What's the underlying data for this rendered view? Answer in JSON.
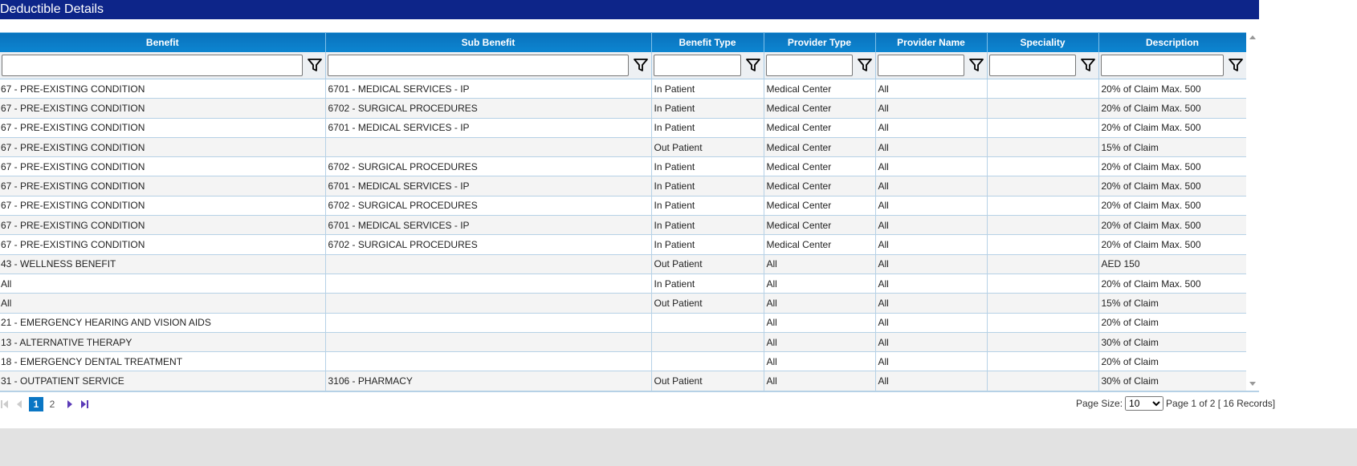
{
  "title": "Deductible Details",
  "columns": [
    "Benefit",
    "Sub Benefit",
    "Benefit Type",
    "Provider Type",
    "Provider Name",
    "Speciality",
    "Description"
  ],
  "rows": [
    [
      "67 - PRE-EXISTING CONDITION",
      "6701 - MEDICAL SERVICES - IP",
      "In Patient",
      "Medical Center",
      "All",
      "",
      "20% of Claim Max. 500"
    ],
    [
      "67 - PRE-EXISTING CONDITION",
      "6702 - SURGICAL PROCEDURES",
      "In Patient",
      "Medical Center",
      "All",
      "",
      "20% of Claim Max. 500"
    ],
    [
      "67 - PRE-EXISTING CONDITION",
      "6701 - MEDICAL SERVICES - IP",
      "In Patient",
      "Medical Center",
      "All",
      "",
      "20% of Claim Max. 500"
    ],
    [
      "67 - PRE-EXISTING CONDITION",
      "",
      "Out Patient",
      "Medical Center",
      "All",
      "",
      "15% of Claim"
    ],
    [
      "67 - PRE-EXISTING CONDITION",
      "6702 - SURGICAL PROCEDURES",
      "In Patient",
      "Medical Center",
      "All",
      "",
      "20% of Claim Max. 500"
    ],
    [
      "67 - PRE-EXISTING CONDITION",
      "6701 - MEDICAL SERVICES - IP",
      "In Patient",
      "Medical Center",
      "All",
      "",
      "20% of Claim Max. 500"
    ],
    [
      "67 - PRE-EXISTING CONDITION",
      "6702 - SURGICAL PROCEDURES",
      "In Patient",
      "Medical Center",
      "All",
      "",
      "20% of Claim Max. 500"
    ],
    [
      "67 - PRE-EXISTING CONDITION",
      "6701 - MEDICAL SERVICES - IP",
      "In Patient",
      "Medical Center",
      "All",
      "",
      "20% of Claim Max. 500"
    ],
    [
      "67 - PRE-EXISTING CONDITION",
      "6702 - SURGICAL PROCEDURES",
      "In Patient",
      "Medical Center",
      "All",
      "",
      "20% of Claim Max. 500"
    ],
    [
      "43 - WELLNESS BENEFIT",
      "",
      "Out Patient",
      "All",
      "All",
      "",
      "AED 150"
    ],
    [
      "All",
      "",
      "In Patient",
      "All",
      "All",
      "",
      "20% of Claim Max. 500"
    ],
    [
      "All",
      "",
      "Out Patient",
      "All",
      "All",
      "",
      "15% of Claim"
    ],
    [
      "21 - EMERGENCY HEARING AND VISION AIDS",
      "",
      "",
      "All",
      "All",
      "",
      "20% of Claim"
    ],
    [
      "13 - ALTERNATIVE THERAPY",
      "",
      "",
      "All",
      "All",
      "",
      "30% of Claim"
    ],
    [
      "18 - EMERGENCY DENTAL TREATMENT",
      "",
      "",
      "All",
      "All",
      "",
      "20% of Claim"
    ],
    [
      "31 - OUTPATIENT SERVICE",
      "3106 - PHARMACY",
      "Out Patient",
      "All",
      "All",
      "",
      "30% of Claim"
    ]
  ],
  "pager": {
    "pages": [
      "1",
      "2"
    ],
    "current": "1",
    "page_size_label": "Page Size:",
    "page_size": "10",
    "info": "Page 1 of 2 [ 16 Records]"
  }
}
